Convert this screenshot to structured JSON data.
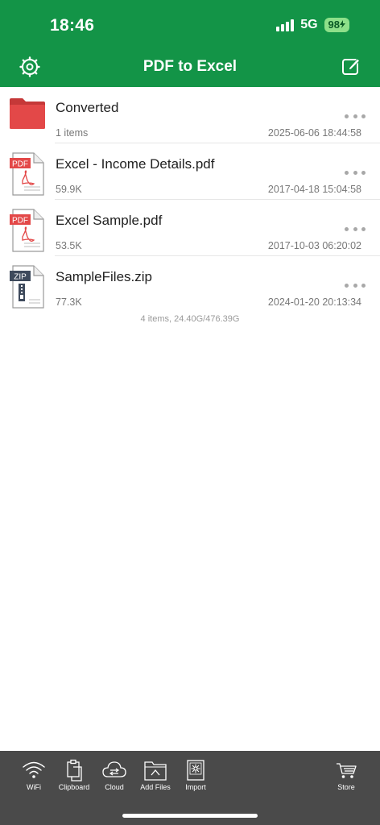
{
  "status_bar": {
    "time": "18:46",
    "network": "5G",
    "battery": "98"
  },
  "nav": {
    "title": "PDF to Excel",
    "settings_icon": "gear-icon",
    "edit_icon": "compose-icon"
  },
  "files": [
    {
      "name": "Converted",
      "meta": "1 items",
      "date": "2025-06-06 18:44:58",
      "type": "folder",
      "icon": "folder-icon"
    },
    {
      "name": "Excel - Income Details.pdf",
      "meta": "59.9K",
      "date": "2017-04-18 15:04:58",
      "type": "pdf",
      "badge": "PDF",
      "icon": "pdf-file-icon"
    },
    {
      "name": "Excel Sample.pdf",
      "meta": "53.5K",
      "date": "2017-10-03 06:20:02",
      "type": "pdf",
      "badge": "PDF",
      "icon": "pdf-file-icon"
    },
    {
      "name": "SampleFiles.zip",
      "meta": "77.3K",
      "date": "2024-01-20 20:13:34",
      "type": "zip",
      "badge": "ZIP",
      "icon": "zip-file-icon"
    }
  ],
  "summary": "4 items, 24.40G/476.39G",
  "toolbar": {
    "wifi": "WiFi",
    "clipboard": "Clipboard",
    "cloud": "Cloud",
    "add_files": "Add Files",
    "import": "Import",
    "store": "Store"
  },
  "colors": {
    "header": "#139447",
    "folder": "#e34848",
    "pdf_badge": "#e34848",
    "zip_badge": "#3e4a5c",
    "toolbar": "#4a4a4a"
  }
}
